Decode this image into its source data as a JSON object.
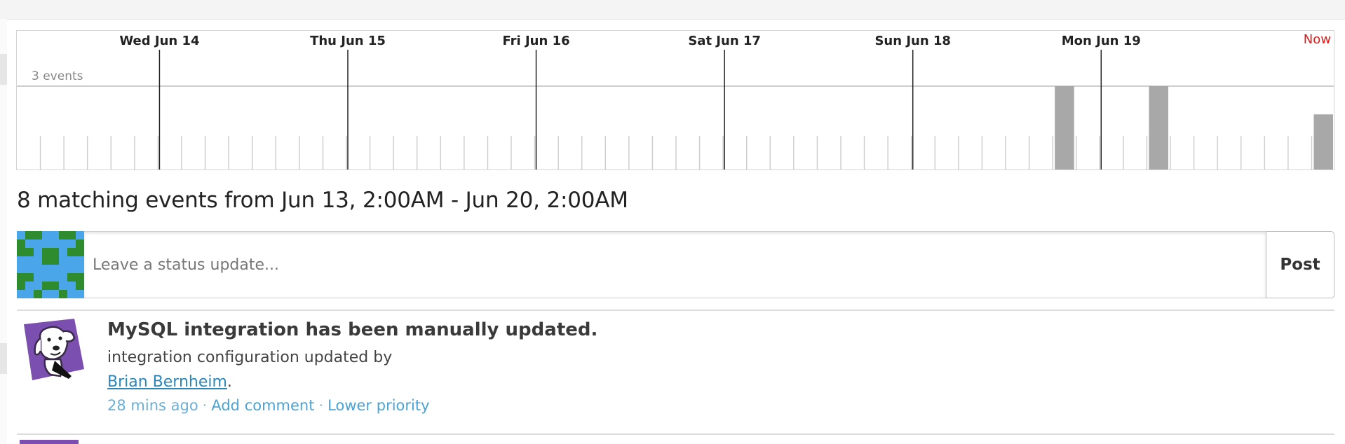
{
  "timeline": {
    "day_labels": [
      "Wed Jun 14",
      "Thu Jun 15",
      "Fri Jun 16",
      "Sat Jun 17",
      "Sun Jun 18",
      "Mon Jun 19"
    ],
    "now_label": "Now",
    "count_label": "3 events",
    "colors": {
      "now": "#e01b1b",
      "bar": "#a8a8a8",
      "tick": "#cfcfcf",
      "day_line": "#222222"
    }
  },
  "chart_data": {
    "type": "bar",
    "x_start": "Jun 13, 2:00AM",
    "x_end": "Jun 20, 2:00AM",
    "bin_hours": 3,
    "ymax": 3,
    "bars": [
      {
        "bin": 44,
        "value": 3
      },
      {
        "bin": 48,
        "value": 3
      },
      {
        "bin": 55,
        "value": 2
      }
    ]
  },
  "summary": "8 matching events from Jun 13, 2:00AM - Jun 20, 2:00AM",
  "status": {
    "placeholder": "Leave a status update...",
    "post_label": "Post"
  },
  "event": {
    "title": "MySQL integration has been manually updated.",
    "description": "integration configuration updated by",
    "author": "Brian Bernheim",
    "author_suffix": ".",
    "time": "28 mins ago",
    "separator": "·",
    "add_comment": "Add comment",
    "lower_priority": "Lower priority"
  }
}
